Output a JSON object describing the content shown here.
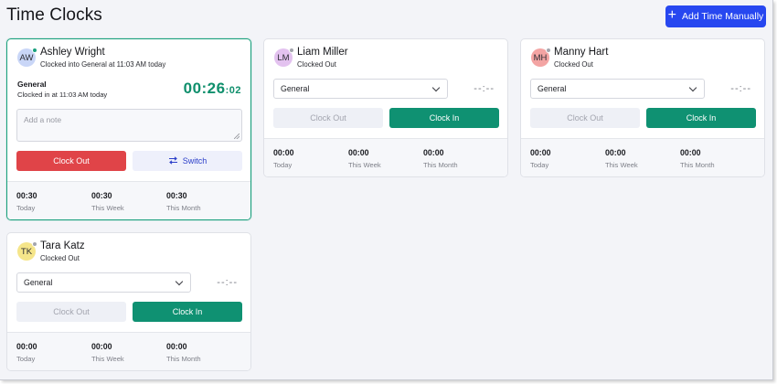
{
  "header": {
    "title": "Time Clocks",
    "add_button_label": "Add Time Manually"
  },
  "colors": {
    "primary_blue": "#2747f0",
    "active_green": "#0f9172",
    "clock_out_red": "#e04448"
  },
  "cards": {
    "ashley": {
      "initials": "AW",
      "name": "Ashley Wright",
      "status": "Clocked into General at 11:03 AM today",
      "online": true,
      "job": "General",
      "clocked_in": "Clocked in at 11:03 AM today",
      "timer_main": "00:26",
      "timer_sec": ":02",
      "note_placeholder": "Add a note",
      "clock_out_label": "Clock Out",
      "switch_label": "Switch",
      "switch_icon": "swap-arrows-icon",
      "stats": [
        {
          "value": "00:30",
          "label": "Today"
        },
        {
          "value": "00:30",
          "label": "This Week"
        },
        {
          "value": "00:30",
          "label": "This Month"
        }
      ]
    },
    "liam": {
      "initials": "LM",
      "name": "Liam Miller",
      "status": "Clocked Out",
      "select_value": "General",
      "time_placeholder": "--:--",
      "clock_out_label": "Clock Out",
      "clock_in_label": "Clock In",
      "stats": [
        {
          "value": "00:00",
          "label": "Today"
        },
        {
          "value": "00:00",
          "label": "This Week"
        },
        {
          "value": "00:00",
          "label": "This Month"
        }
      ]
    },
    "manny": {
      "initials": "MH",
      "name": "Manny Hart",
      "status": "Clocked Out",
      "select_value": "General",
      "time_placeholder": "--:--",
      "clock_out_label": "Clock Out",
      "clock_in_label": "Clock In",
      "stats": [
        {
          "value": "00:00",
          "label": "Today"
        },
        {
          "value": "00:00",
          "label": "This Week"
        },
        {
          "value": "00:00",
          "label": "This Month"
        }
      ]
    },
    "tara": {
      "initials": "TK",
      "name": "Tara Katz",
      "status": "Clocked Out",
      "select_value": "General",
      "time_placeholder": "--:--",
      "clock_out_label": "Clock Out",
      "clock_in_label": "Clock In",
      "stats": [
        {
          "value": "00:00",
          "label": "Today"
        },
        {
          "value": "00:00",
          "label": "This Week"
        },
        {
          "value": "00:00",
          "label": "This Month"
        }
      ]
    }
  }
}
